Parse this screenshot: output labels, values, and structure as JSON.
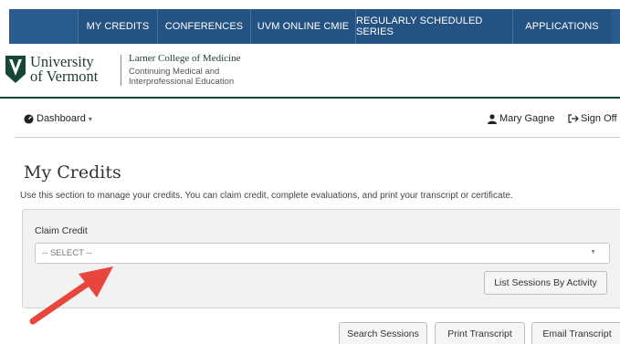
{
  "nav": {
    "items": [
      {
        "label": "MY CREDITS"
      },
      {
        "label": "CONFERENCES"
      },
      {
        "label": "UVM ONLINE CMIE"
      },
      {
        "label": "REGULARLY SCHEDULED SERIES"
      },
      {
        "label": "APPLICATIONS"
      }
    ],
    "bg_color": "#2a5b8f"
  },
  "brand": {
    "university_line1": "University",
    "university_line2": "of Vermont",
    "college": "Larner College of Medicine",
    "dept_line1": "Continuing Medical and",
    "dept_line2": "Interprofessional Education",
    "accent_color": "#154734"
  },
  "userbar": {
    "dashboard_label": "Dashboard",
    "dashboard_icon": "tachometer-icon",
    "user_name": "Mary Gagne",
    "user_icon": "user-icon",
    "signoff_label": "Sign Off",
    "signoff_icon": "sign-out-icon"
  },
  "page": {
    "title": "My Credits",
    "description": "Use this section to manage your credits. You can claim credit, complete evaluations, and print your transcript or certificate."
  },
  "claim": {
    "label": "Claim Credit",
    "select_value": "-- SELECT --",
    "list_sessions_button": "List Sessions By Activity"
  },
  "actions": {
    "search_sessions": "Search Sessions",
    "print_transcript": "Print Transcript",
    "email_transcript": "Email Transcript"
  },
  "annotation": {
    "arrow_color": "#e8453c"
  }
}
